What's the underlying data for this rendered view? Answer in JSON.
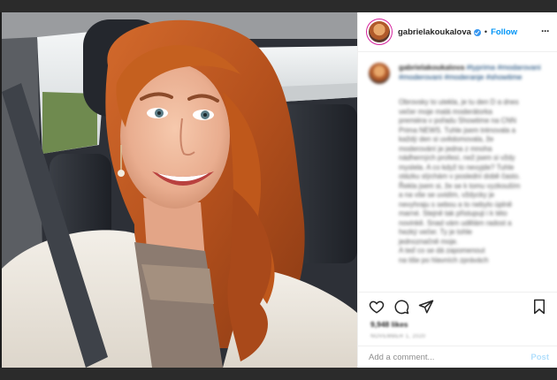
{
  "header": {
    "username": "gabrielakoukalova",
    "separator": "•",
    "follow_label": "Follow",
    "more_icon": "more-horizontal-icon"
  },
  "caption": {
    "username": "gabrielakoukalova",
    "hashtags": "#typrima #modarovani #moderovani #moderanje #showtime",
    "lines": [
      "Obrovsky to utekla, je tu den D a dnes",
      "večer moje malá moderátorka",
      "premiéra v pořadu Showtime na CNN",
      "Prima NEWS. Tuhle jsem trénovala a",
      "každý den si uvědomovala, že",
      "moderování je jedna z mnoha",
      "nádherných profesí, než jsem si vždy",
      "myslela. A co když to nevyjde? Tuhle",
      "otázku slýchám v poslední době často.",
      "Řekla jsem si, že se k tomu vyzkouším",
      "a na vše se uvidím, vždycky je",
      "nevyhraju s sebou a to nebylo úplně",
      "marné. Stejně tak přistupuji i k této",
      "novinkě. Snad vám udělám radost a",
      "hezký večer. Ty je tohle",
      "jednoznačně moje.",
      "A teď co se dá zapomenout",
      "na tiše po hlavních zprávách"
    ]
  },
  "actions": {
    "like_icon": "heart-icon",
    "comment_icon": "comment-icon",
    "share_icon": "paper-plane-icon",
    "bookmark_icon": "bookmark-icon"
  },
  "likes": "9,948 likes",
  "date": "November 1, 2020",
  "comment": {
    "placeholder": "Add a comment...",
    "post_label": "Post"
  },
  "colors": {
    "accent": "#0095f6",
    "verified": "#3897f0",
    "post_disabled": "#b2dffc",
    "text": "#262626",
    "muted": "#8e8e8e"
  }
}
